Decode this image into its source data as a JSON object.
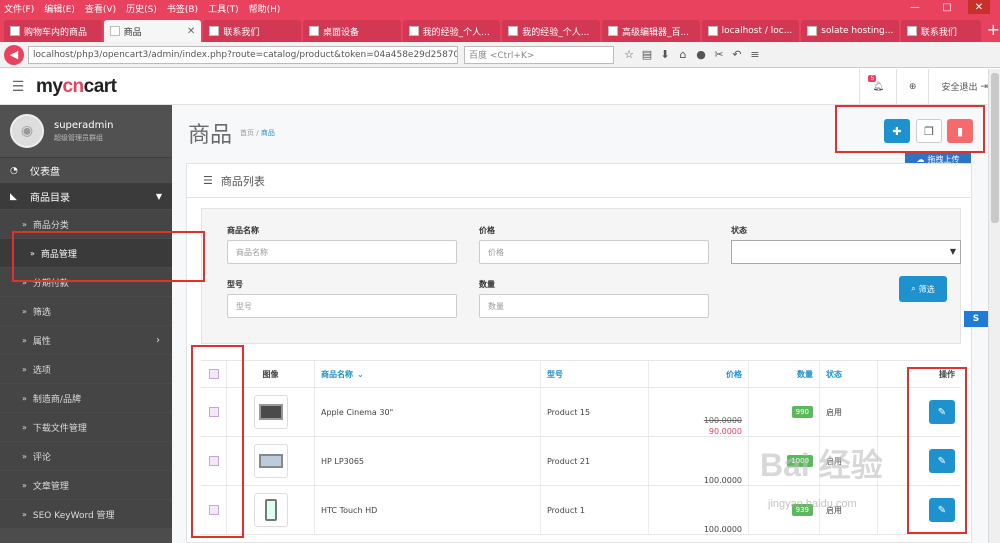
{
  "browser": {
    "menu": [
      "文件(F)",
      "编辑(E)",
      "查看(V)",
      "历史(S)",
      "书签(B)",
      "工具(T)",
      "帮助(H)"
    ],
    "tabs": [
      {
        "label": "购物车内的商品"
      },
      {
        "label": "商品",
        "active": true
      },
      {
        "label": "联系我们"
      },
      {
        "label": "桌面设备"
      },
      {
        "label": "我的经验_个人..."
      },
      {
        "label": "我的经验_个人..."
      },
      {
        "label": "高级编辑器_百..."
      },
      {
        "label": "localhost / loc..."
      },
      {
        "label": "solate hosting..."
      },
      {
        "label": "联系我们"
      }
    ],
    "url": "localhost/php3/opencart3/admin/index.php?route=catalog/product&token=04a458e29d25870",
    "search_placeholder": "百度 <Ctrl+K>"
  },
  "header": {
    "logo_my": "my",
    "logo_cn": "cn",
    "logo_cart": "cart",
    "notification_count": "5",
    "logout_label": "安全退出"
  },
  "sidebar": {
    "user_name": "superadmin",
    "user_role": "超级管理员群组",
    "dashboard": "仪表盘",
    "catalog": "商品目录",
    "items": [
      {
        "label": "商品分类"
      },
      {
        "label": "商品管理",
        "active": true
      },
      {
        "label": "分期付款"
      },
      {
        "label": "筛选"
      },
      {
        "label": "属性"
      },
      {
        "label": "选项"
      },
      {
        "label": "制造商/品牌"
      },
      {
        "label": "下载文件管理"
      },
      {
        "label": "评论"
      },
      {
        "label": "文章管理"
      },
      {
        "label": "SEO KeyWord 管理"
      }
    ]
  },
  "page": {
    "title": "商品",
    "breadcrumb_home": "首页",
    "breadcrumb_current": "商品",
    "upload_label": "拖拽上传",
    "panel_title": "商品列表"
  },
  "filter": {
    "name_label": "商品名称",
    "name_placeholder": "商品名称",
    "price_label": "价格",
    "price_placeholder": "价格",
    "status_label": "状态",
    "model_label": "型号",
    "model_placeholder": "型号",
    "quantity_label": "数量",
    "quantity_placeholder": "数量",
    "filter_button": "筛选"
  },
  "table": {
    "headers": {
      "image": "图像",
      "name": "商品名称",
      "model": "型号",
      "price": "价格",
      "quantity": "数量",
      "status": "状态",
      "action": "操作"
    },
    "rows": [
      {
        "name": "Apple Cinema 30\"",
        "model": "Product 15",
        "price": "100.0000",
        "special": "90.0000",
        "quantity": "990",
        "status": "启用",
        "image": "monitor"
      },
      {
        "name": "HP LP3065",
        "model": "Product 21",
        "price": "100.0000",
        "special": "",
        "quantity": "1000",
        "status": "启用",
        "image": "laptop"
      },
      {
        "name": "HTC Touch HD",
        "model": "Product 1",
        "price": "100.0000",
        "special": "",
        "quantity": "939",
        "status": "启用",
        "image": "phone"
      }
    ]
  },
  "watermark": {
    "line1": "Bai 经验",
    "line2": "jingyan.baidu.com"
  },
  "colors": {
    "brand_red": "#e8425f",
    "primary_blue": "#1e91cf",
    "sidebar_bg": "#4c4c4c",
    "annotation_red": "#e0302f"
  }
}
